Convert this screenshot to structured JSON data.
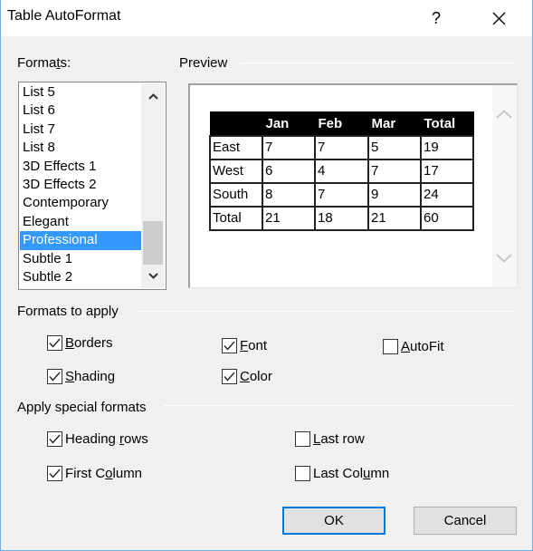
{
  "window": {
    "title": "Table AutoFormat",
    "help_label": "?",
    "close_icon": "close-icon"
  },
  "formats": {
    "label": "Formats:",
    "label_mnemonic": "t",
    "items": [
      "List 5",
      "List 6",
      "List 7",
      "List 8",
      "3D Effects 1",
      "3D Effects 2",
      "Contemporary",
      "Elegant",
      "Professional",
      "Subtle 1",
      "Subtle 2"
    ],
    "selected": "Professional"
  },
  "preview": {
    "label": "Preview",
    "table": {
      "headers": [
        "",
        "Jan",
        "Feb",
        "Mar",
        "Total"
      ],
      "rows": [
        [
          "East",
          "7",
          "7",
          "5",
          "19"
        ],
        [
          "West",
          "6",
          "4",
          "7",
          "17"
        ],
        [
          "South",
          "8",
          "7",
          "9",
          "24"
        ],
        [
          "Total",
          "21",
          "18",
          "21",
          "60"
        ]
      ]
    }
  },
  "formats_to_apply": {
    "label": "Formats to apply",
    "options": [
      {
        "label": "Borders",
        "mnemonic": "B",
        "checked": true
      },
      {
        "label": "Font",
        "mnemonic": "F",
        "checked": true
      },
      {
        "label": "AutoFit",
        "mnemonic": "A",
        "checked": false
      },
      {
        "label": "Shading",
        "mnemonic": "S",
        "checked": true
      },
      {
        "label": "Color",
        "mnemonic": "C",
        "checked": true
      }
    ]
  },
  "special_formats": {
    "label": "Apply special formats",
    "options": [
      {
        "label": "Heading rows",
        "mnemonic": "r",
        "checked": true
      },
      {
        "label": "Last row",
        "mnemonic": "L",
        "checked": false
      },
      {
        "label": "First Column",
        "mnemonic": "o",
        "checked": true
      },
      {
        "label": "Last Column",
        "mnemonic": "u",
        "checked": false
      }
    ]
  },
  "buttons": {
    "ok": "OK",
    "cancel": "Cancel"
  },
  "colors": {
    "accent": "#0078d7",
    "selection": "#3399ff",
    "dialog_bg": "#f0f0f0",
    "window_border": "#6fb0e8"
  }
}
